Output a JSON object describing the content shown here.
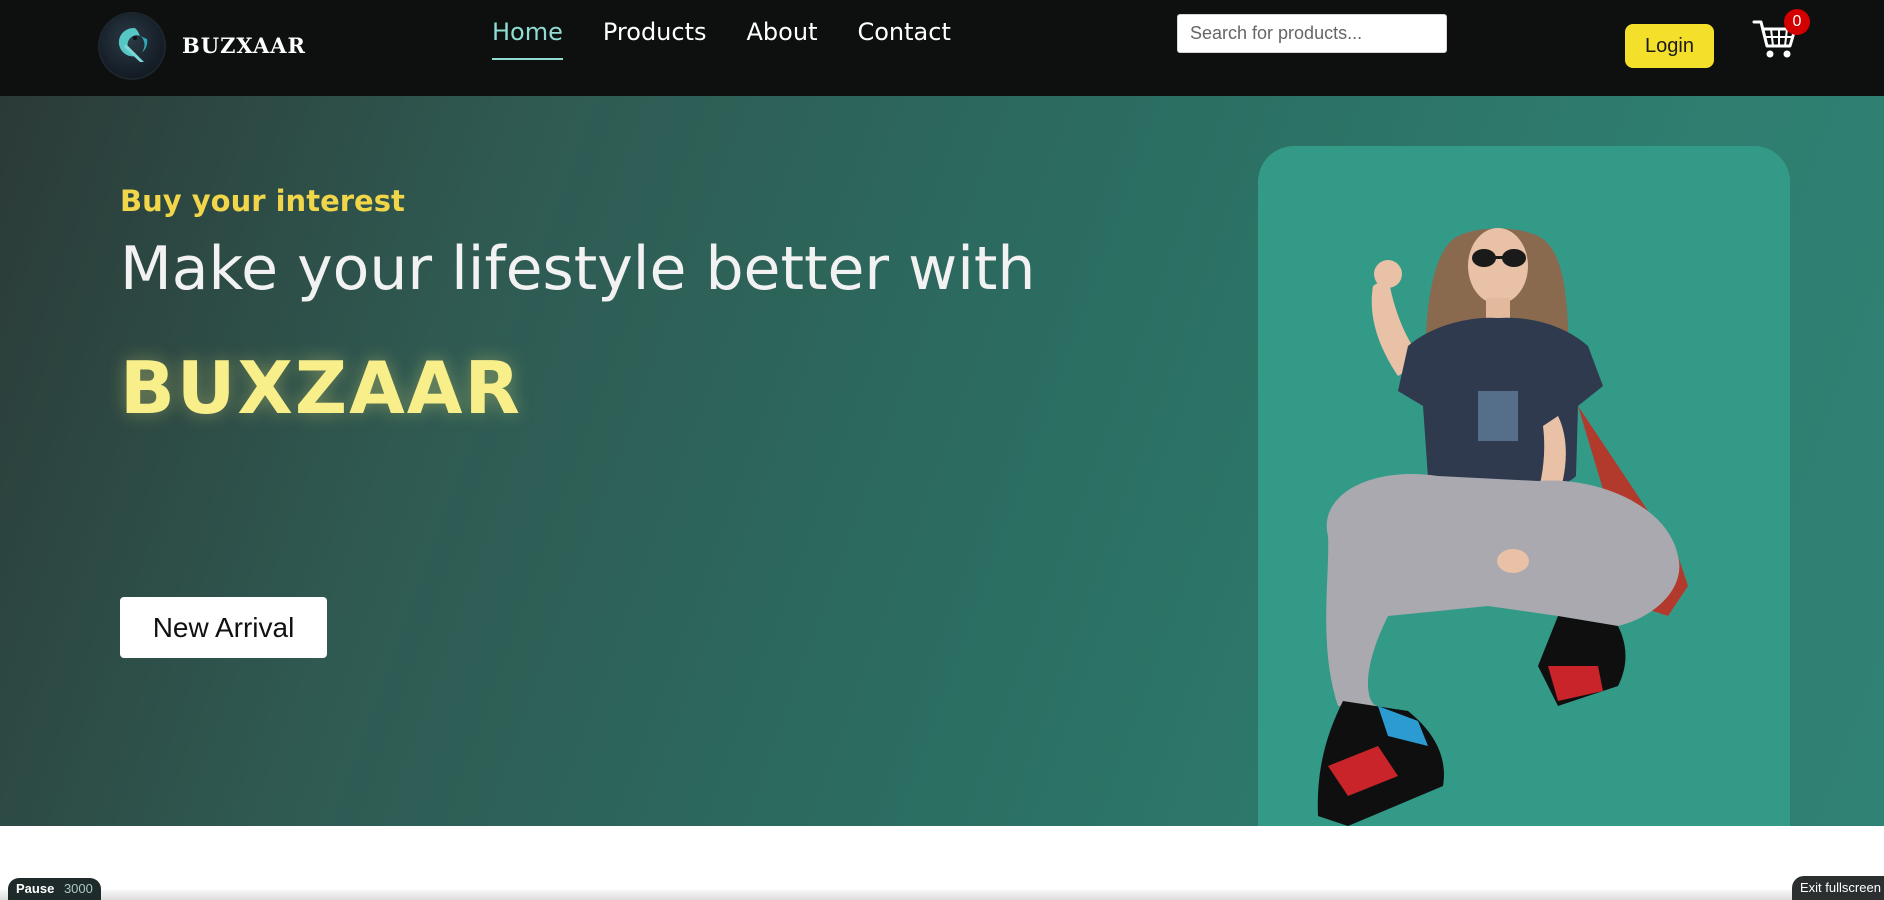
{
  "header": {
    "brand": "BUZXAAR",
    "nav": [
      {
        "label": "Home",
        "active": true
      },
      {
        "label": "Products",
        "active": false
      },
      {
        "label": "About",
        "active": false
      },
      {
        "label": "Contact",
        "active": false
      }
    ],
    "search": {
      "placeholder": "Search for products...",
      "value": ""
    },
    "login_label": "Login",
    "cart_count": "0",
    "icons": {
      "logo": "brand-logo-icon",
      "cart": "cart-icon"
    }
  },
  "hero": {
    "tagline": "Buy your interest",
    "headline": "Make your lifestyle better with",
    "brand": "BUXZAAR",
    "cta_label": "New Arrival",
    "image_alt": "model-sitting-image"
  },
  "overlay": {
    "pause_label": "Pause",
    "left_number": "3000",
    "exit_label": "Exit fullscreen"
  },
  "colors": {
    "nav_bg": "#0e0f0f",
    "accent_teal": "#8fdcd3",
    "hero_yellow": "#f2d64a",
    "login_yellow": "#f4e02a",
    "badge_red": "#d40000",
    "card_teal": "#349a88"
  }
}
